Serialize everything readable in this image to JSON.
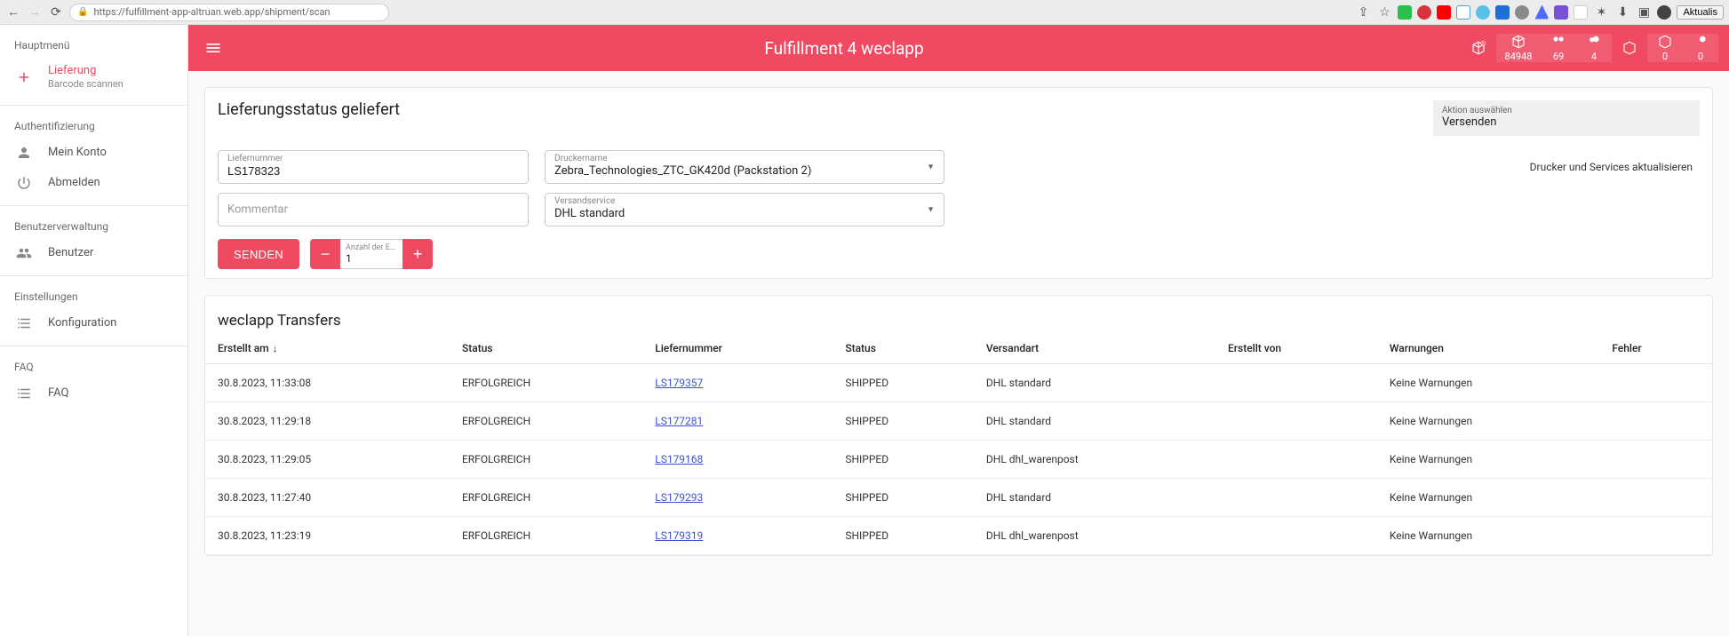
{
  "browser": {
    "url": "https://fulfillment-app-altruan.web.app/shipment/scan",
    "refresh_button": "Aktualis"
  },
  "sidebar": {
    "sections": {
      "main": {
        "title": "Hauptmenü"
      },
      "auth": {
        "title": "Authentifizierung"
      },
      "users": {
        "title": "Benutzerverwaltung"
      },
      "settings": {
        "title": "Einstellungen"
      },
      "faq": {
        "title": "FAQ"
      }
    },
    "lieferung": {
      "label": "Lieferung",
      "sub": "Barcode scannen"
    },
    "konto": {
      "label": "Mein Konto"
    },
    "abmelden": {
      "label": "Abmelden"
    },
    "benutzer": {
      "label": "Benutzer"
    },
    "konfiguration": {
      "label": "Konfiguration"
    },
    "faq_item": {
      "label": "FAQ"
    }
  },
  "appbar": {
    "title": "Fulfillment 4 weclapp",
    "stats": {
      "a": "84948",
      "b": "69",
      "c": "4",
      "d": "0",
      "e": "0"
    }
  },
  "form": {
    "title": "Lieferungsstatus geliefert",
    "action_select": {
      "label": "Aktion auswählen",
      "value": "Versenden"
    },
    "refresh_link": "Drucker und Services aktualisieren",
    "liefernummer": {
      "label": "Liefernummer",
      "value": "LS178323"
    },
    "druckername": {
      "label": "Druckername",
      "value": "Zebra_Technologies_ZTC_GK420d (Packstation 2)"
    },
    "kommentar": {
      "label": "Kommentar",
      "value": ""
    },
    "versandservice": {
      "label": "Versandservice",
      "value": "DHL standard"
    },
    "send_btn": "SENDEN",
    "etiketten": {
      "label": "Anzahl der Etik…",
      "value": "1"
    }
  },
  "transfers": {
    "title": "weclapp Transfers",
    "headers": {
      "erstellt": "Erstellt am",
      "status1": "Status",
      "liefernummer": "Liefernummer",
      "status2": "Status",
      "versandart": "Versandart",
      "erstellt_von": "Erstellt von",
      "warnungen": "Warnungen",
      "fehler": "Fehler"
    },
    "rows": [
      {
        "erstellt": "30.8.2023, 11:33:08",
        "status1": "ERFOLGREICH",
        "ln": "LS179357",
        "status2": "SHIPPED",
        "versand": "DHL standard",
        "von": "",
        "warn": "Keine Warnungen",
        "fehler": ""
      },
      {
        "erstellt": "30.8.2023, 11:29:18",
        "status1": "ERFOLGREICH",
        "ln": "LS177281",
        "status2": "SHIPPED",
        "versand": "DHL standard",
        "von": "",
        "warn": "Keine Warnungen",
        "fehler": ""
      },
      {
        "erstellt": "30.8.2023, 11:29:05",
        "status1": "ERFOLGREICH",
        "ln": "LS179168",
        "status2": "SHIPPED",
        "versand": "DHL dhl_warenpost",
        "von": "",
        "warn": "Keine Warnungen",
        "fehler": ""
      },
      {
        "erstellt": "30.8.2023, 11:27:40",
        "status1": "ERFOLGREICH",
        "ln": "LS179293",
        "status2": "SHIPPED",
        "versand": "DHL standard",
        "von": "",
        "warn": "Keine Warnungen",
        "fehler": ""
      },
      {
        "erstellt": "30.8.2023, 11:23:19",
        "status1": "ERFOLGREICH",
        "ln": "LS179319",
        "status2": "SHIPPED",
        "versand": "DHL dhl_warenpost",
        "von": "",
        "warn": "Keine Warnungen",
        "fehler": ""
      }
    ]
  }
}
